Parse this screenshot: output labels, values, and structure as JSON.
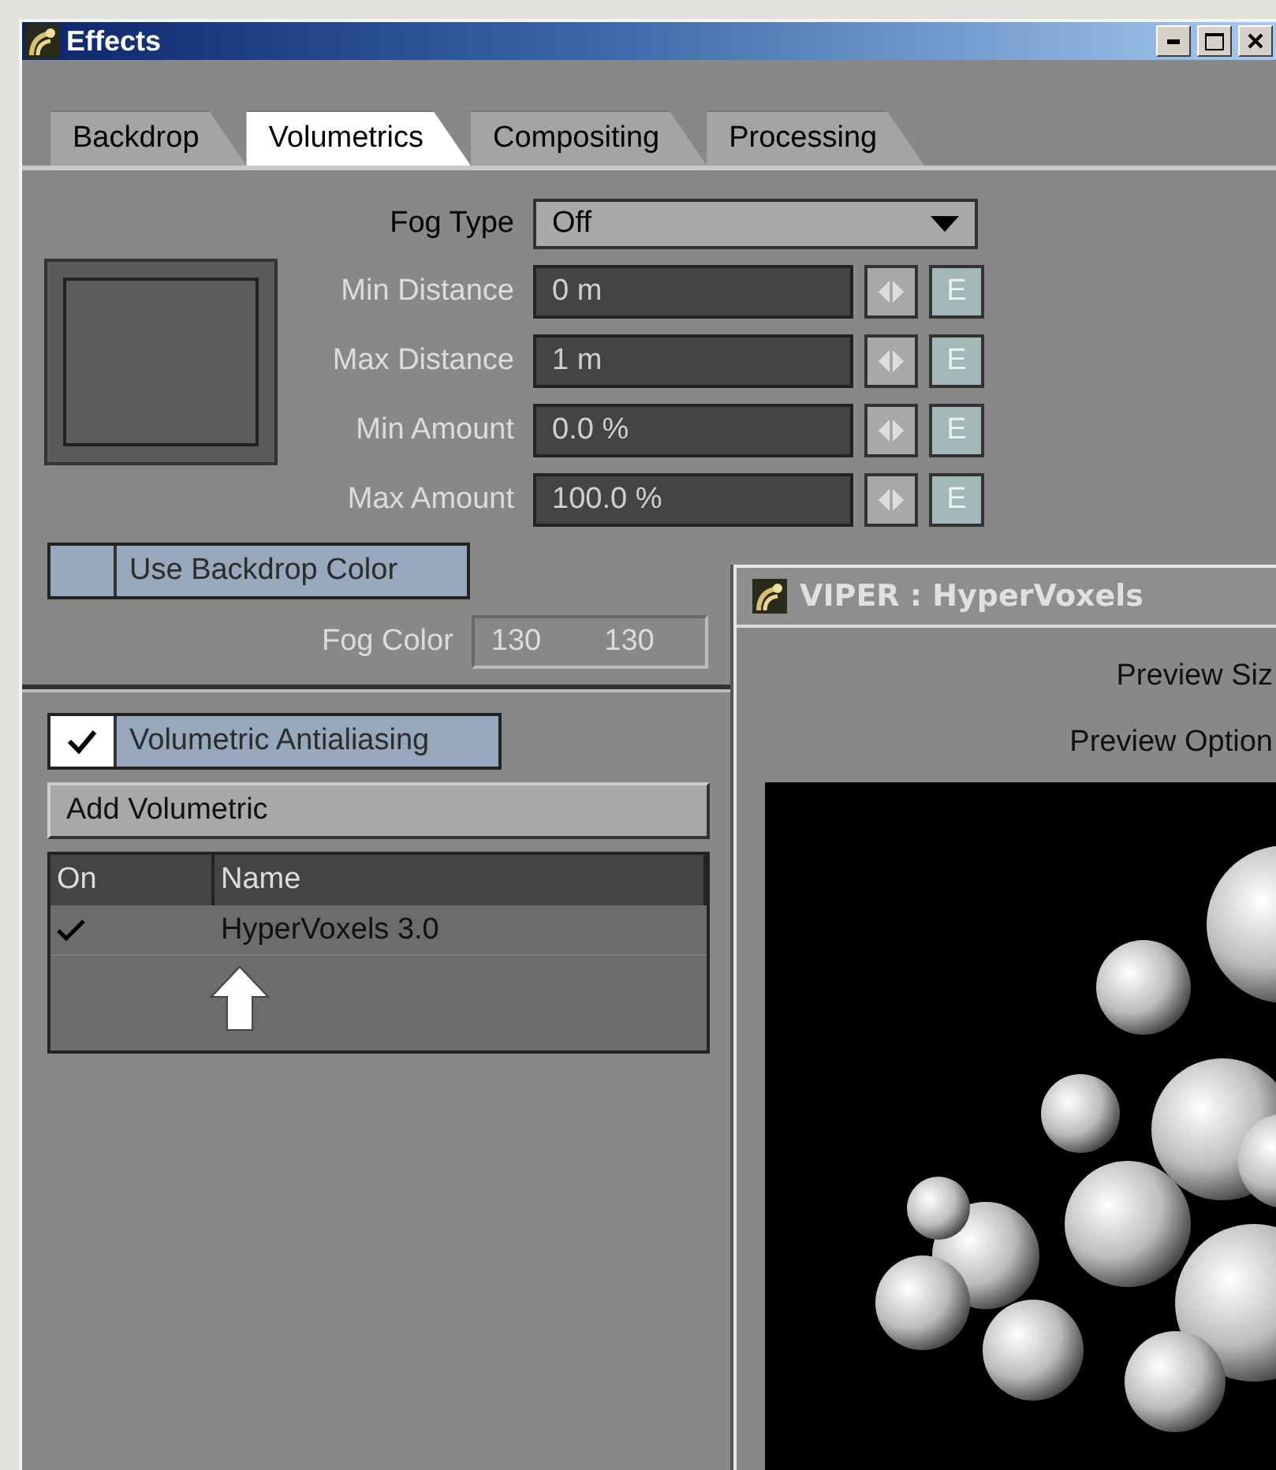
{
  "window": {
    "title": "Effects"
  },
  "tabs": [
    {
      "label": "Backdrop",
      "selected": false
    },
    {
      "label": "Volumetrics",
      "selected": true
    },
    {
      "label": "Compositing",
      "selected": false
    },
    {
      "label": "Processing",
      "selected": false
    }
  ],
  "fog_type": {
    "label": "Fog Type",
    "value": "Off"
  },
  "parameters": [
    {
      "label": "Min Distance",
      "value": "0 m",
      "envelope": "E",
      "disabled": true
    },
    {
      "label": "Max Distance",
      "value": "1 m",
      "envelope": "E",
      "disabled": true
    },
    {
      "label": "Min Amount",
      "value": "0.0 %",
      "envelope": "E",
      "disabled": true
    },
    {
      "label": "Max Amount",
      "value": "100.0 %",
      "envelope": "E",
      "disabled": true
    }
  ],
  "use_backdrop_color": {
    "label": "Use Backdrop Color",
    "checked": false
  },
  "fog_color": {
    "label": "Fog Color",
    "values": [
      "130",
      "130"
    ],
    "disabled": true
  },
  "volumetric_antialiasing": {
    "label": "Volumetric Antialiasing",
    "checked": true
  },
  "add_button": "Add Volumetric",
  "table": {
    "columns": [
      "On",
      "Name"
    ],
    "rows": [
      {
        "on": true,
        "name": "HyperVoxels 3.0"
      }
    ]
  },
  "viper_window": {
    "title": "VIPER : HyperVoxels",
    "labels": [
      "Preview Siz",
      "Preview Option"
    ]
  }
}
